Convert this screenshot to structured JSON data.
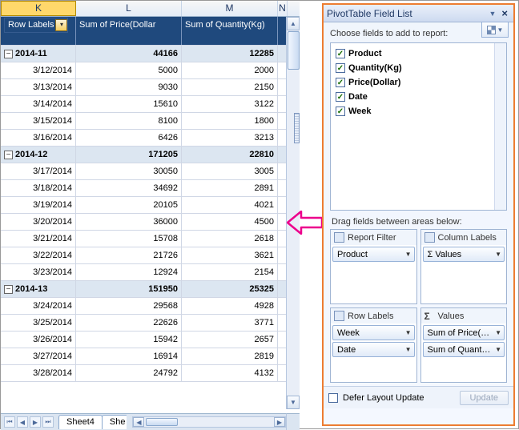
{
  "columns": {
    "k": "K",
    "l": "L",
    "m": "M",
    "n": "N"
  },
  "pivot_headers": {
    "row_labels": "Row Labels",
    "sum_price": "Sum of Price(Dollar",
    "sum_qty": "Sum of Quantity(Kg)"
  },
  "rows": [
    {
      "type": "group",
      "label": "2014-11",
      "price": "44166",
      "qty": "12285"
    },
    {
      "type": "data",
      "label": "3/12/2014",
      "price": "5000",
      "qty": "2000"
    },
    {
      "type": "data",
      "label": "3/13/2014",
      "price": "9030",
      "qty": "2150"
    },
    {
      "type": "data",
      "label": "3/14/2014",
      "price": "15610",
      "qty": "3122"
    },
    {
      "type": "data",
      "label": "3/15/2014",
      "price": "8100",
      "qty": "1800"
    },
    {
      "type": "data",
      "label": "3/16/2014",
      "price": "6426",
      "qty": "3213"
    },
    {
      "type": "group",
      "label": "2014-12",
      "price": "171205",
      "qty": "22810"
    },
    {
      "type": "data",
      "label": "3/17/2014",
      "price": "30050",
      "qty": "3005"
    },
    {
      "type": "data",
      "label": "3/18/2014",
      "price": "34692",
      "qty": "2891"
    },
    {
      "type": "data",
      "label": "3/19/2014",
      "price": "20105",
      "qty": "4021"
    },
    {
      "type": "data",
      "label": "3/20/2014",
      "price": "36000",
      "qty": "4500"
    },
    {
      "type": "data",
      "label": "3/21/2014",
      "price": "15708",
      "qty": "2618"
    },
    {
      "type": "data",
      "label": "3/22/2014",
      "price": "21726",
      "qty": "3621"
    },
    {
      "type": "data",
      "label": "3/23/2014",
      "price": "12924",
      "qty": "2154"
    },
    {
      "type": "group",
      "label": "2014-13",
      "price": "151950",
      "qty": "25325"
    },
    {
      "type": "data",
      "label": "3/24/2014",
      "price": "29568",
      "qty": "4928"
    },
    {
      "type": "data",
      "label": "3/25/2014",
      "price": "22626",
      "qty": "3771"
    },
    {
      "type": "data",
      "label": "3/26/2014",
      "price": "15942",
      "qty": "2657"
    },
    {
      "type": "data",
      "label": "3/27/2014",
      "price": "16914",
      "qty": "2819"
    },
    {
      "type": "data",
      "label": "3/28/2014",
      "price": "24792",
      "qty": "4132"
    }
  ],
  "tabs": {
    "active": "Sheet4",
    "next": "She"
  },
  "field_list": {
    "title": "PivotTable Field List",
    "prompt": "Choose fields to add to report:",
    "fields": [
      "Product",
      "Quantity(Kg)",
      "Price(Dollar)",
      "Date",
      "Week"
    ],
    "drag_label": "Drag fields between areas below:",
    "areas": {
      "report_filter": {
        "title": "Report Filter",
        "items": [
          "Product"
        ]
      },
      "column_labels": {
        "title": "Column Labels",
        "items": [
          "Σ Values"
        ]
      },
      "row_labels": {
        "title": "Row Labels",
        "items": [
          "Week",
          "Date"
        ]
      },
      "values": {
        "title": "Values",
        "items": [
          "Sum of Price(…",
          "Sum of Quant…"
        ]
      }
    },
    "defer_label": "Defer Layout Update",
    "update_label": "Update"
  }
}
